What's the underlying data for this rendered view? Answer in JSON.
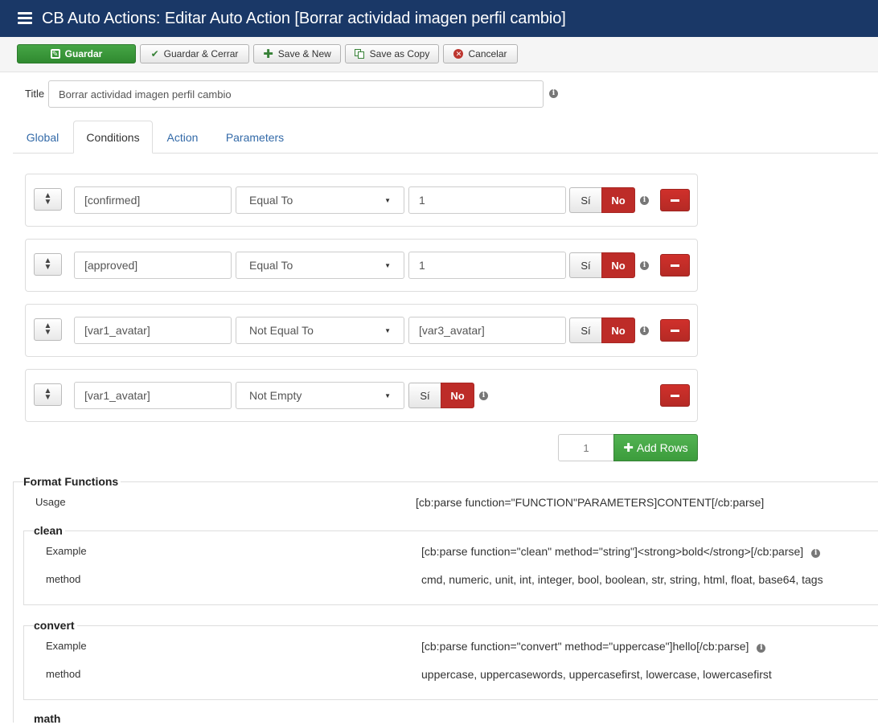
{
  "header": {
    "title": "CB Auto Actions: Editar Auto Action [Borrar actividad imagen perfil cambio]"
  },
  "toolbar": {
    "save": "Guardar",
    "save_close": "Guardar & Cerrar",
    "save_new": "Save & New",
    "save_copy": "Save as Copy",
    "cancel": "Cancelar"
  },
  "form": {
    "title_label": "Title",
    "title_value": "Borrar actividad imagen perfil cambio"
  },
  "tabs": {
    "global": "Global",
    "conditions": "Conditions",
    "action": "Action",
    "parameters": "Parameters"
  },
  "conditions": [
    {
      "field": "[confirmed]",
      "operator": "Equal To",
      "value": "1",
      "yes": "Sí",
      "no": "No"
    },
    {
      "field": "[approved]",
      "operator": "Equal To",
      "value": "1",
      "yes": "Sí",
      "no": "No"
    },
    {
      "field": "[var1_avatar]",
      "operator": "Not Equal To",
      "value": "[var3_avatar]",
      "yes": "Sí",
      "no": "No"
    },
    {
      "field": "[var1_avatar]",
      "operator": "Not Empty",
      "yes": "Sí",
      "no": "No"
    }
  ],
  "add_rows": {
    "count": "1",
    "label": "Add Rows"
  },
  "format_functions": {
    "title": "Format Functions",
    "usage_label": "Usage",
    "usage_value": "[cb:parse function=\"FUNCTION\"PARAMETERS]CONTENT[/cb:parse]",
    "clean": {
      "title": "clean",
      "example_label": "Example",
      "example_value": "[cb:parse function=\"clean\" method=\"string\"]<strong>bold</strong>[/cb:parse]",
      "method_label": "method",
      "method_value": "cmd, numeric, unit, int, integer, bool, boolean, str, string, html, float, base64, tags"
    },
    "convert": {
      "title": "convert",
      "example_label": "Example",
      "example_value": "[cb:parse function=\"convert\" method=\"uppercase\"]hello[/cb:parse]",
      "method_label": "method",
      "method_value": "uppercase, uppercasewords, uppercasefirst, lowercase, lowercasefirst"
    },
    "math": {
      "title": "math"
    }
  },
  "icons": {
    "header": "list-icon",
    "info": "info-icon",
    "drag": "sort-handle-icon",
    "remove": "minus-icon"
  },
  "colors": {
    "header_bg": "#1a3867",
    "primary_green": "#2f8a2f",
    "danger_red": "#bd2c28",
    "link_blue": "#336aa8"
  }
}
